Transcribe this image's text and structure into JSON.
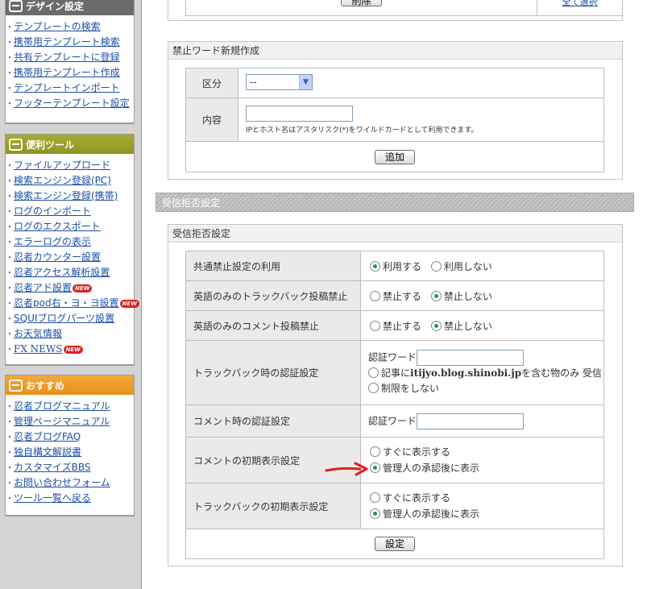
{
  "sidebar": {
    "design": {
      "title": "デザイン設定",
      "items": [
        "テンプレートの検索",
        "携帯用テンプレート検索",
        "共有テンプレートに登録",
        "携帯用テンプレート作成",
        "テンプレートインポート",
        "フッターテンプレート設定"
      ]
    },
    "tools": {
      "title": "便利ツール",
      "items": [
        "ファイルアップロード",
        "検索エンジン登録(PC)",
        "検索エンジン登録(携帯)",
        "ログのインポート",
        "ログのエクスポート",
        "エラーログの表示",
        "忍者カウンター設置",
        "忍者アクセス解析設置",
        "忍者アド設置",
        "忍者pod右・ヨ・ヨ設置",
        "SQUIブログパーツ設置",
        "お天気情報",
        "FX NEWS"
      ],
      "new_badge": "NEW"
    },
    "recommend": {
      "title": "おすすめ",
      "items": [
        "忍者ブログマニュアル",
        "管理ページマニュアル",
        "忍者ブログFAQ",
        "独自構文解説書",
        "カスタマイズBBS",
        "お問い合わせフォーム",
        "ツール一覧へ戻る"
      ]
    }
  },
  "top_partial": {
    "delete_button": "削除",
    "select_all_link": "全て選択"
  },
  "ng_word": {
    "title": "禁止ワード新規作成",
    "category_label": "区分",
    "category_value": "--",
    "content_label": "内容",
    "content_value": "",
    "content_hint": "IPとホスト名はアスタリスク(*)をワイルドカードとして利用できます。",
    "add_button": "追加"
  },
  "reject_section": {
    "bar_title": "受信拒否設定",
    "panel_title": "受信拒否設定",
    "rows": {
      "common": {
        "label": "共通禁止設定の利用",
        "opt1": "利用する",
        "opt2": "利用しない",
        "selected": 1
      },
      "tb_english": {
        "label": "英語のみのトラックバック投稿禁止",
        "opt1": "禁止する",
        "opt2": "禁止しない",
        "selected": 2
      },
      "cm_english": {
        "label": "英語のみのコメント投稿禁止",
        "opt1": "禁止する",
        "opt2": "禁止しない",
        "selected": 2
      },
      "tb_auth": {
        "label": "トラックバック時の認証設定",
        "word_label": "認証ワード",
        "word_value": "",
        "opt1_prefix": "記事に",
        "opt1_domain": "itijyo.blog.shinobi.jp",
        "opt1_suffix": "を含む物のみ 受信",
        "opt2": "制限をしない"
      },
      "cm_auth": {
        "label": "コメント時の認証設定",
        "word_label": "認証ワード",
        "word_value": ""
      },
      "cm_display": {
        "label": "コメントの初期表示設定",
        "opt1": "すぐに表示する",
        "opt2": "管理人の承認後に表示",
        "selected": 2
      },
      "tb_display": {
        "label": "トラックバックの初期表示設定",
        "opt1": "すぐに表示する",
        "opt2": "管理人の承認後に表示",
        "selected": 2
      }
    },
    "submit_button": "設定"
  },
  "colors": {
    "link": "#1d4fa8",
    "tools_header": "#9aa12b",
    "recommend_header": "#ee9a27",
    "annotation_arrow": "#e01e1e"
  }
}
